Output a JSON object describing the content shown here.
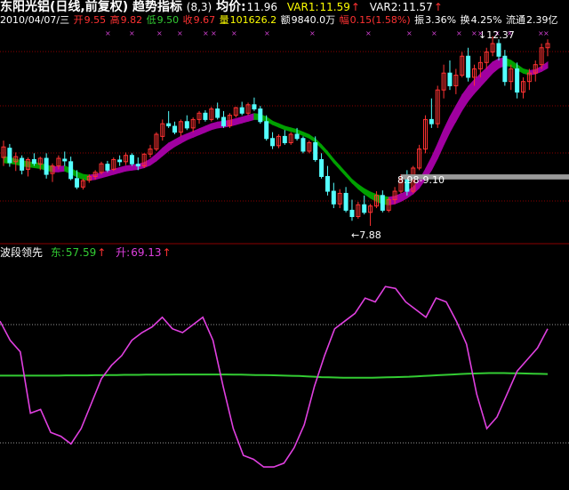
{
  "header": {
    "stock_title": "东阳光铝(日线,前复权)",
    "indicator_name": "趋势指标",
    "indicator_params": "(8,3)",
    "avg_label": "均价:",
    "avg_value": "11.96",
    "var1_label": "VAR1:",
    "var1_value": "11.59",
    "var1_arrow": "↑",
    "var2_label": "VAR2:",
    "var2_value": "11.57",
    "var2_arrow": "↑"
  },
  "quote": {
    "date": "2010/04/07/三",
    "open_label": "开",
    "open": "9.55",
    "high_label": "高",
    "high": "9.82",
    "low_label": "低",
    "low": "9.50",
    "close_label": "收",
    "close": "9.67",
    "volume_label": "量",
    "volume": "101626.2",
    "amount_label": "额",
    "amount": "9840.0万",
    "change_label": "幅",
    "change": "0.15(1.58%)",
    "amplitude_label": "振",
    "amplitude": "3.36%",
    "turnover_label": "换",
    "turnover": "4.25%",
    "float_label": "流通",
    "float_value": "2.39亿"
  },
  "annotations": {
    "high_marker": "12.37",
    "low_marker": "7.88",
    "range_label": "8.98-9.10"
  },
  "sub_header": {
    "name": "波段领先",
    "east_label": "东:",
    "east_value": "57.59",
    "east_arrow": "↑",
    "rise_label": "升:",
    "rise_value": "69.13",
    "rise_arrow": "↑"
  },
  "colors": {
    "background": "#000000",
    "up": "#ff3232",
    "down": "#54ffff",
    "band_up": "#a000a0",
    "band_down": "#00a000",
    "grid": "#8b0000",
    "east_line": "#33cc33",
    "rise_line": "#e040e0",
    "label_white": "#ffffff",
    "label_yellow": "#ffff00"
  },
  "chart_data": [
    {
      "type": "candlestick",
      "panel": "price",
      "ylim": [
        7.5,
        12.6
      ],
      "candles": [
        [
          9.5,
          9.9,
          9.3,
          9.75
        ],
        [
          9.72,
          9.82,
          9.28,
          9.38
        ],
        [
          9.4,
          9.62,
          9.18,
          9.52
        ],
        [
          9.48,
          9.55,
          9.1,
          9.2
        ],
        [
          9.22,
          9.5,
          9.05,
          9.45
        ],
        [
          9.45,
          9.6,
          9.3,
          9.36
        ],
        [
          9.34,
          9.52,
          9.2,
          9.48
        ],
        [
          9.48,
          9.6,
          9.0,
          9.1
        ],
        [
          9.12,
          9.36,
          8.92,
          9.3
        ],
        [
          9.3,
          9.55,
          9.22,
          9.48
        ],
        [
          9.46,
          9.64,
          9.3,
          9.42
        ],
        [
          9.4,
          9.52,
          8.96,
          9.0
        ],
        [
          9.0,
          9.2,
          8.75,
          8.8
        ],
        [
          8.8,
          9.0,
          8.74,
          8.95
        ],
        [
          8.96,
          9.1,
          8.9,
          9.05
        ],
        [
          9.05,
          9.2,
          8.98,
          9.15
        ],
        [
          9.15,
          9.4,
          9.1,
          9.35
        ],
        [
          9.34,
          9.42,
          9.15,
          9.2
        ],
        [
          9.22,
          9.5,
          9.18,
          9.45
        ],
        [
          9.44,
          9.55,
          9.3,
          9.4
        ],
        [
          9.4,
          9.62,
          9.32,
          9.55
        ],
        [
          9.55,
          9.6,
          9.3,
          9.35
        ],
        [
          9.34,
          9.5,
          9.2,
          9.3
        ],
        [
          9.3,
          9.6,
          9.25,
          9.58
        ],
        [
          9.58,
          9.8,
          9.5,
          9.7
        ],
        [
          9.7,
          10.1,
          9.65,
          10.05
        ],
        [
          10.0,
          10.4,
          9.9,
          10.3
        ],
        [
          10.3,
          10.6,
          10.2,
          10.25
        ],
        [
          10.24,
          10.35,
          10.05,
          10.1
        ],
        [
          10.1,
          10.4,
          10.0,
          10.35
        ],
        [
          10.35,
          10.5,
          10.15,
          10.2
        ],
        [
          10.2,
          10.45,
          10.1,
          10.4
        ],
        [
          10.4,
          10.6,
          10.3,
          10.55
        ],
        [
          10.55,
          10.62,
          10.35,
          10.4
        ],
        [
          10.4,
          10.7,
          10.35,
          10.65
        ],
        [
          10.65,
          10.8,
          10.4,
          10.45
        ],
        [
          10.45,
          10.6,
          10.2,
          10.25
        ],
        [
          10.25,
          10.55,
          10.2,
          10.5
        ],
        [
          10.5,
          10.7,
          10.45,
          10.68
        ],
        [
          10.68,
          10.82,
          10.5,
          10.55
        ],
        [
          10.55,
          10.8,
          10.5,
          10.75
        ],
        [
          10.75,
          10.92,
          10.6,
          10.65
        ],
        [
          10.65,
          10.72,
          10.3,
          10.35
        ],
        [
          10.35,
          10.5,
          9.9,
          9.95
        ],
        [
          9.95,
          10.1,
          9.7,
          9.78
        ],
        [
          9.78,
          10.05,
          9.72,
          10.0
        ],
        [
          10.0,
          10.15,
          9.8,
          9.85
        ],
        [
          9.85,
          10.1,
          9.8,
          10.05
        ],
        [
          10.05,
          10.2,
          9.9,
          9.95
        ],
        [
          9.95,
          10.0,
          9.6,
          9.65
        ],
        [
          9.65,
          9.9,
          9.6,
          9.85
        ],
        [
          9.85,
          10.0,
          9.4,
          9.45
        ],
        [
          9.45,
          9.6,
          9.0,
          9.05
        ],
        [
          9.05,
          9.3,
          8.6,
          8.7
        ],
        [
          8.7,
          8.9,
          8.3,
          8.4
        ],
        [
          8.4,
          8.75,
          8.3,
          8.65
        ],
        [
          8.65,
          8.8,
          8.2,
          8.25
        ],
        [
          8.25,
          8.5,
          8.0,
          8.1
        ],
        [
          8.1,
          8.45,
          8.05,
          8.38
        ],
        [
          8.38,
          8.6,
          8.15,
          8.2
        ],
        [
          8.2,
          8.4,
          7.88,
          8.35
        ],
        [
          8.35,
          8.7,
          8.3,
          8.6
        ],
        [
          8.6,
          8.72,
          8.2,
          8.25
        ],
        [
          8.25,
          8.55,
          8.2,
          8.5
        ],
        [
          8.5,
          8.8,
          8.4,
          8.7
        ],
        [
          8.7,
          9.1,
          8.65,
          9.0
        ],
        [
          9.0,
          9.2,
          8.6,
          8.7
        ],
        [
          8.7,
          9.3,
          8.65,
          9.25
        ],
        [
          9.25,
          9.8,
          9.2,
          9.7
        ],
        [
          9.7,
          10.5,
          9.6,
          10.4
        ],
        [
          10.4,
          10.9,
          10.2,
          10.3
        ],
        [
          10.3,
          11.2,
          10.2,
          11.1
        ],
        [
          11.1,
          11.7,
          10.9,
          11.5
        ],
        [
          11.5,
          11.8,
          11.1,
          11.2
        ],
        [
          11.2,
          11.6,
          11.0,
          11.45
        ],
        [
          11.45,
          12.0,
          11.4,
          11.9
        ],
        [
          11.9,
          12.1,
          11.3,
          11.4
        ],
        [
          11.4,
          11.7,
          11.2,
          11.6
        ],
        [
          11.6,
          11.9,
          11.4,
          11.75
        ],
        [
          11.75,
          12.1,
          11.6,
          12.0
        ],
        [
          12.0,
          12.37,
          11.9,
          12.2
        ],
        [
          12.2,
          12.3,
          11.8,
          11.9
        ],
        [
          11.9,
          12.05,
          11.2,
          11.3
        ],
        [
          11.3,
          11.7,
          11.1,
          11.6
        ],
        [
          11.6,
          11.75,
          10.9,
          11.05
        ],
        [
          11.05,
          11.4,
          10.9,
          11.3
        ],
        [
          11.3,
          11.6,
          11.1,
          11.5
        ],
        [
          11.5,
          11.8,
          11.3,
          11.7
        ],
        [
          11.7,
          12.2,
          11.6,
          12.1
        ],
        [
          12.1,
          12.3,
          11.9,
          12.2
        ]
      ],
      "band": {
        "upper": [
          9.52,
          9.5,
          9.46,
          9.42,
          9.4,
          9.38,
          9.36,
          9.32,
          9.28,
          9.28,
          9.3,
          9.24,
          9.16,
          9.1,
          9.08,
          9.1,
          9.14,
          9.18,
          9.22,
          9.26,
          9.3,
          9.32,
          9.34,
          9.38,
          9.46,
          9.58,
          9.72,
          9.84,
          9.92,
          10.0,
          10.06,
          10.12,
          10.18,
          10.24,
          10.3,
          10.34,
          10.36,
          10.38,
          10.42,
          10.46,
          10.5,
          10.54,
          10.52,
          10.46,
          10.36,
          10.3,
          10.24,
          10.2,
          10.16,
          10.1,
          10.04,
          9.94,
          9.8,
          9.64,
          9.46,
          9.3,
          9.14,
          8.98,
          8.86,
          8.76,
          8.68,
          8.62,
          8.58,
          8.56,
          8.58,
          8.64,
          8.7,
          8.8,
          8.96,
          9.22,
          9.5,
          9.82,
          10.16,
          10.46,
          10.72,
          10.98,
          11.18,
          11.34,
          11.48,
          11.62,
          11.76,
          11.84,
          11.86,
          11.8,
          11.7,
          11.6,
          11.56,
          11.58,
          11.66,
          11.76
        ],
        "lower": [
          9.38,
          9.36,
          9.34,
          9.3,
          9.28,
          9.26,
          9.24,
          9.2,
          9.16,
          9.16,
          9.18,
          9.12,
          9.04,
          8.98,
          8.96,
          8.98,
          9.02,
          9.06,
          9.1,
          9.14,
          9.18,
          9.2,
          9.22,
          9.26,
          9.32,
          9.42,
          9.54,
          9.66,
          9.76,
          9.84,
          9.92,
          9.98,
          10.04,
          10.1,
          10.16,
          10.2,
          10.22,
          10.24,
          10.28,
          10.32,
          10.36,
          10.4,
          10.4,
          10.36,
          10.28,
          10.22,
          10.16,
          10.12,
          10.08,
          10.02,
          9.96,
          9.86,
          9.72,
          9.56,
          9.38,
          9.22,
          9.06,
          8.9,
          8.76,
          8.64,
          8.54,
          8.46,
          8.4,
          8.38,
          8.4,
          8.46,
          8.54,
          8.64,
          8.78,
          8.98,
          9.2,
          9.48,
          9.8,
          10.1,
          10.36,
          10.62,
          10.84,
          11.02,
          11.18,
          11.34,
          11.5,
          11.62,
          11.68,
          11.66,
          11.58,
          11.5,
          11.46,
          11.48,
          11.54,
          11.62
        ]
      }
    },
    {
      "type": "line",
      "panel": "oscillator",
      "ylim": [
        -10,
        110
      ],
      "series": [
        {
          "name": "东",
          "values": [
            49.6,
            49.6,
            49.6,
            49.6,
            49.6,
            49.6,
            49.6,
            49.6,
            49.6,
            49.7,
            49.7,
            49.7,
            49.7,
            49.8,
            49.8,
            49.9,
            49.9,
            50.0,
            50.0,
            50.0,
            50.1,
            50.1,
            50.1,
            50.1,
            50.2,
            50.2,
            50.2,
            50.2,
            50.2,
            50.2,
            50.2,
            50.2,
            50.1,
            50.1,
            50.0,
            49.9,
            49.9,
            49.8,
            49.7,
            49.6,
            49.5,
            49.4,
            49.2,
            49.0,
            48.8,
            48.7,
            48.6,
            48.5,
            48.5,
            48.5,
            48.5,
            48.5,
            48.6,
            48.7,
            48.8,
            48.9,
            49.0,
            49.2,
            49.4,
            49.6,
            49.8,
            50.0,
            50.2,
            50.4,
            50.6,
            50.7,
            50.8,
            50.9,
            50.9,
            50.9,
            50.8,
            50.8,
            50.7,
            50.6,
            50.5,
            50.4
          ]
        },
        {
          "name": "升",
          "values": [
            78,
            68,
            62,
            30,
            32,
            20,
            18,
            14,
            22,
            35,
            48,
            55,
            60,
            68,
            72,
            75,
            80,
            74,
            72,
            76,
            80,
            68,
            44,
            22,
            8,
            6,
            2,
            2,
            4,
            12,
            24,
            44,
            60,
            74,
            78,
            82,
            90,
            88,
            96,
            95,
            88,
            84,
            80,
            90,
            88,
            78,
            66,
            40,
            22,
            28,
            40,
            52,
            58,
            64,
            74
          ]
        }
      ]
    }
  ]
}
